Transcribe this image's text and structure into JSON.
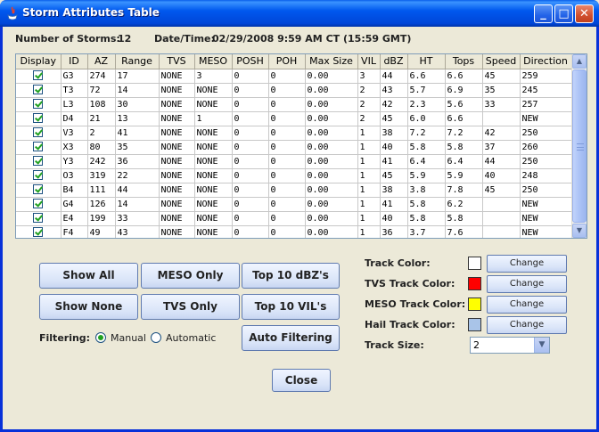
{
  "window": {
    "title": "Storm Attributes Table",
    "min_glyph": "_",
    "max_glyph": "□",
    "close_glyph": "✕"
  },
  "info": {
    "storms_label": "Number of Storms:",
    "storms_value": "12",
    "datetime_label": "Date/Time:",
    "datetime_value": "02/29/2008 9:59 AM CT (15:59 GMT)"
  },
  "table": {
    "columns": [
      "Display",
      "ID",
      "AZ",
      "Range",
      "TVS",
      "MESO",
      "POSH",
      "POH",
      "Max Size",
      "VIL",
      "dBZ",
      "HT",
      "Tops",
      "Speed",
      "Direction"
    ],
    "rows": [
      [
        "G3",
        "274",
        "17",
        "NONE",
        "3",
        "0",
        "0",
        "0.00",
        "3",
        "44",
        "6.6",
        "6.6",
        "45",
        "259"
      ],
      [
        "T3",
        "72",
        "14",
        "NONE",
        "NONE",
        "0",
        "0",
        "0.00",
        "2",
        "43",
        "5.7",
        "6.9",
        "35",
        "245"
      ],
      [
        "L3",
        "108",
        "30",
        "NONE",
        "NONE",
        "0",
        "0",
        "0.00",
        "2",
        "42",
        "2.3",
        "5.6",
        "33",
        "257"
      ],
      [
        "D4",
        "21",
        "13",
        "NONE",
        "1",
        "0",
        "0",
        "0.00",
        "2",
        "45",
        "6.0",
        "6.6",
        "",
        "NEW"
      ],
      [
        "V3",
        "2",
        "41",
        "NONE",
        "NONE",
        "0",
        "0",
        "0.00",
        "1",
        "38",
        "7.2",
        "7.2",
        "42",
        "250"
      ],
      [
        "X3",
        "80",
        "35",
        "NONE",
        "NONE",
        "0",
        "0",
        "0.00",
        "1",
        "40",
        "5.8",
        "5.8",
        "37",
        "260"
      ],
      [
        "Y3",
        "242",
        "36",
        "NONE",
        "NONE",
        "0",
        "0",
        "0.00",
        "1",
        "41",
        "6.4",
        "6.4",
        "44",
        "250"
      ],
      [
        "O3",
        "319",
        "22",
        "NONE",
        "NONE",
        "0",
        "0",
        "0.00",
        "1",
        "45",
        "5.9",
        "5.9",
        "40",
        "248"
      ],
      [
        "B4",
        "111",
        "44",
        "NONE",
        "NONE",
        "0",
        "0",
        "0.00",
        "1",
        "38",
        "3.8",
        "7.8",
        "45",
        "250"
      ],
      [
        "G4",
        "126",
        "14",
        "NONE",
        "NONE",
        "0",
        "0",
        "0.00",
        "1",
        "41",
        "5.8",
        "6.2",
        "",
        "NEW"
      ],
      [
        "E4",
        "199",
        "33",
        "NONE",
        "NONE",
        "0",
        "0",
        "0.00",
        "1",
        "40",
        "5.8",
        "5.8",
        "",
        "NEW"
      ],
      [
        "F4",
        "49",
        "43",
        "NONE",
        "NONE",
        "0",
        "0",
        "0.00",
        "1",
        "36",
        "3.7",
        "7.6",
        "",
        "NEW"
      ]
    ]
  },
  "buttons": {
    "show_all": "Show All",
    "meso_only": "MESO Only",
    "top10_dbz": "Top 10 dBZ's",
    "show_none": "Show None",
    "tvs_only": "TVS Only",
    "top10_vil": "Top 10 VIL's",
    "auto_filtering": "Auto Filtering",
    "close": "Close"
  },
  "filtering": {
    "label": "Filtering:",
    "manual": "Manual",
    "automatic": "Automatic",
    "selected": "Manual"
  },
  "tracks": {
    "change_label": "Change",
    "items": [
      {
        "label": "Track Color:",
        "color": "#FFFFFF"
      },
      {
        "label": "TVS Track Color:",
        "color": "#FF0000"
      },
      {
        "label": "MESO Track Color:",
        "color": "#FFFF00"
      },
      {
        "label": "Hail Track Color:",
        "color": "#A9C4E8"
      }
    ],
    "size_label": "Track Size:",
    "size_value": "2"
  }
}
